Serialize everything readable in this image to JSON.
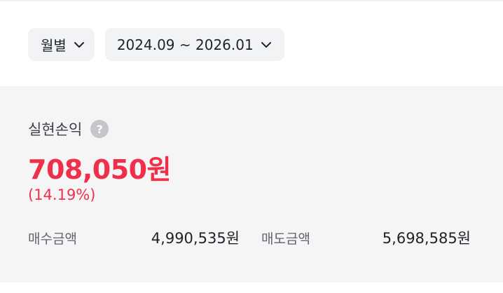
{
  "filters": {
    "period_label": "월별",
    "range_label": "2024.09 ~ 2026.01"
  },
  "summary": {
    "label": "실현손익",
    "help_symbol": "?",
    "amount": "708,050원",
    "rate": "(14.19%)",
    "buy_label": "매수금액",
    "buy_value": "4,990,535원",
    "sell_label": "매도금액",
    "sell_value": "5,698,585원"
  },
  "colors": {
    "profit": "#f0304a",
    "panel_background": "#f5f5f6",
    "filter_background": "#f2f3f5"
  }
}
